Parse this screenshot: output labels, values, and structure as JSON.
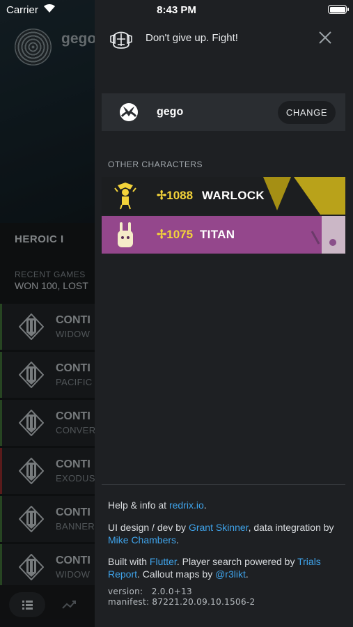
{
  "status_bar": {
    "carrier": "Carrier",
    "time": "8:43 PM"
  },
  "background": {
    "username": "gego",
    "rank": "HEROIC I",
    "recent_label": "RECENT GAMES",
    "recent_value": "WON 100, LOST",
    "games": [
      {
        "title": "CONTI",
        "subtitle": "WIDOW",
        "result": "win"
      },
      {
        "title": "CONTI",
        "subtitle": "PACIFIC",
        "result": "win"
      },
      {
        "title": "CONTI",
        "subtitle": "CONVER",
        "result": "win"
      },
      {
        "title": "CONTI",
        "subtitle": "EXODUS",
        "result": "loss"
      },
      {
        "title": "CONTI",
        "subtitle": "BANNER",
        "result": "win"
      },
      {
        "title": "CONTI",
        "subtitle": "WIDOW",
        "result": "win"
      }
    ]
  },
  "drawer": {
    "tagline": "Don't give up. Fight!",
    "account": {
      "platform_icon": "xbox-icon",
      "name": "gego",
      "change_label": "CHANGE"
    },
    "other_label": "OTHER CHARACTERS",
    "characters": [
      {
        "light": "✢1088",
        "class": "WARLOCK",
        "color": "#1c1e20"
      },
      {
        "light": "✢1075",
        "class": "TITAN",
        "color": "#94478c"
      }
    ],
    "info": {
      "help_prefix": "Help & info at ",
      "help_link": "redrix.io",
      "help_suffix": ".",
      "design_prefix": "UI design / dev by ",
      "design_link": "Grant Skinner",
      "design_mid": ", data integration by ",
      "data_link": "Mike Chambers",
      "design_suffix": ".",
      "built_prefix": "Built with ",
      "built_link": "Flutter",
      "built_mid": ". Player search powered by ",
      "trials_link": "Trials Report",
      "built_mid2": ". Callout maps by ",
      "maps_link": "@r3likt",
      "built_suffix": "."
    },
    "version": "version:   2.0.0+13",
    "manifest": "manifest: 87221.20.09.10.1506-2"
  },
  "colors": {
    "link": "#3fa3ea",
    "light_level": "#f3d33a",
    "warlock_accent": "#b9a21a",
    "titan_bg": "#94478c"
  }
}
